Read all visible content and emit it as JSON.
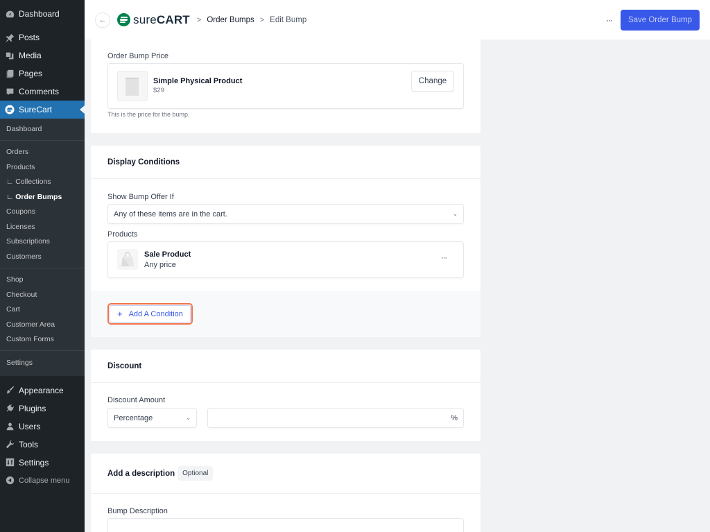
{
  "sidebar": {
    "top_items": [
      {
        "label": "Dashboard",
        "icon": "dashboard-icon"
      },
      {
        "label": "Posts",
        "icon": "pin-icon"
      },
      {
        "label": "Media",
        "icon": "media-icon"
      },
      {
        "label": "Pages",
        "icon": "pages-icon"
      },
      {
        "label": "Comments",
        "icon": "comment-icon"
      }
    ],
    "active_item": {
      "label": "SureCart",
      "icon": "surecart-icon"
    },
    "submenu": {
      "group1": [
        "Dashboard"
      ],
      "group2": [
        "Orders",
        "Products",
        "∟ Collections",
        "∟ Order Bumps",
        "Coupons",
        "Licenses",
        "Subscriptions",
        "Customers"
      ],
      "group3": [
        "Shop",
        "Checkout",
        "Cart",
        "Customer Area",
        "Custom Forms"
      ],
      "group4": [
        "Settings"
      ],
      "current": "∟ Order Bumps"
    },
    "bottom_items": [
      {
        "label": "Appearance",
        "icon": "brush-icon"
      },
      {
        "label": "Plugins",
        "icon": "plugin-icon"
      },
      {
        "label": "Users",
        "icon": "user-icon"
      },
      {
        "label": "Tools",
        "icon": "wrench-icon"
      },
      {
        "label": "Settings",
        "icon": "settings-icon"
      }
    ],
    "collapse_label": "Collapse menu"
  },
  "header": {
    "logo_light": "sure",
    "logo_bold": "CART",
    "breadcrumbs": [
      "Order Bumps",
      "Edit Bump"
    ],
    "more_label": "···",
    "save_label": "Save Order Bump",
    "accent_color": "#3858e9"
  },
  "price_card": {
    "label": "Order Bump Price",
    "product_name": "Simple Physical Product",
    "product_price": "$29",
    "change_label": "Change",
    "help_text": "This is the price for the bump."
  },
  "display_conditions": {
    "title": "Display Conditions",
    "show_if_label": "Show Bump Offer If",
    "show_if_value": "Any of these items are in the cart.",
    "products_label": "Products",
    "products": [
      {
        "name": "Sale Product",
        "price": "Any price"
      }
    ],
    "add_condition_label": "Add A Condition"
  },
  "discount": {
    "title": "Discount",
    "amount_label": "Discount Amount",
    "type_value": "Percentage",
    "amount_value": "",
    "suffix": "%"
  },
  "description": {
    "title": "Add a description",
    "badge": "Optional",
    "field_label": "Bump Description",
    "field_value": ""
  }
}
